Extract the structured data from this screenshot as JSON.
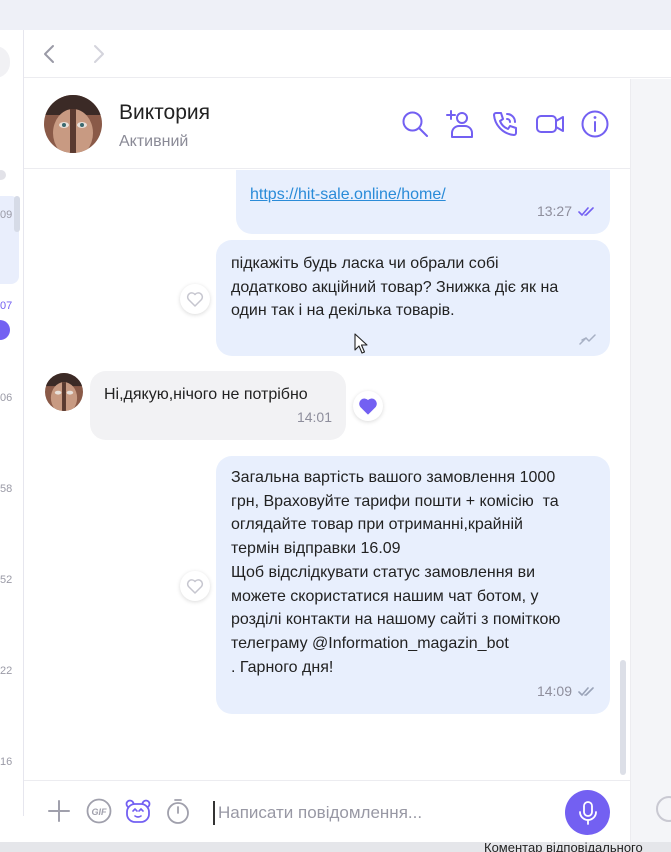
{
  "left_sidebar": {
    "times": [
      "09",
      "07",
      "06",
      "58",
      "52",
      "22",
      "16"
    ]
  },
  "chat": {
    "contact_name": "Виктория",
    "contact_status": "Активний"
  },
  "messages": [
    {
      "direction": "out",
      "text": "https://hit-sale.online/home/",
      "time": "13:27",
      "status": "read",
      "is_link": true
    },
    {
      "direction": "out",
      "text": "підкажіть будь ласка чи обрали собі\nдодатково акційний товар? Знижка діє як на\nодин так і на декілька товарів.",
      "time": "",
      "status": "delivered"
    },
    {
      "direction": "in",
      "text": "Ні,дякую,нічого не потрібно",
      "time": "14:01",
      "reaction": "liked"
    },
    {
      "direction": "out",
      "text": "Загальна вартість вашого замовлення 1000\nгрн, Враховуйте тарифи пошти + комісію  та\nоглядайте товар при отриманні,крайній\nтермін відправки 16.09\nЩоб відслідкувати статус замовлення ви\nможете скористатися нашим чат ботом, у\nрозділі контакти на нашому сайті з поміткою\nтелеграму @Information_magazin_bot\n. Гарного дня!",
      "time": "14:09",
      "status": "read"
    }
  ],
  "composer": {
    "placeholder": "Написати повідомлення..."
  },
  "footer": {
    "label": "Коментар відповідального"
  },
  "colors": {
    "accent": "#7360f2",
    "outgoing_bubble": "#e8effd",
    "incoming_bubble": "#f2f2f4",
    "link": "#2a8bd8"
  },
  "icons": {
    "header": [
      "search-icon",
      "add-contact-icon",
      "call-icon",
      "video-call-icon",
      "info-icon"
    ],
    "composer": [
      "plus-icon",
      "gif-icon",
      "sticker-icon",
      "timer-icon",
      "microphone-icon"
    ]
  }
}
